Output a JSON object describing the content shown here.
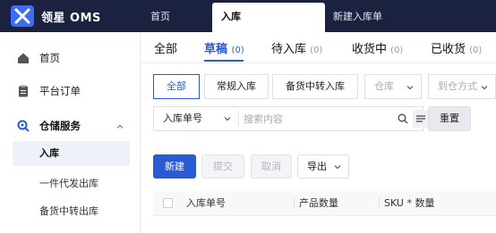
{
  "header": {
    "app_title": "领星 OMS",
    "tabs": [
      {
        "label": "首页"
      },
      {
        "label": "入库"
      },
      {
        "label": "新建入库单"
      }
    ]
  },
  "sidebar": {
    "items": [
      {
        "label": "首页",
        "icon": "home-icon"
      },
      {
        "label": "平台订单",
        "icon": "clipboard-icon"
      },
      {
        "label": "仓储服务",
        "icon": "warehouse-icon"
      }
    ],
    "sub_items": [
      {
        "label": "入库"
      },
      {
        "label": "一件代发出库"
      },
      {
        "label": "备货中转出库"
      }
    ]
  },
  "status_tabs": [
    {
      "label": "全部",
      "count": ""
    },
    {
      "label": "草稿",
      "count": "(0)"
    },
    {
      "label": "待入库",
      "count": "(0)"
    },
    {
      "label": "收货中",
      "count": "(0)"
    },
    {
      "label": "已收货",
      "count": "(0)"
    }
  ],
  "filters": {
    "type_buttons": [
      {
        "label": "全部"
      },
      {
        "label": "常规入库"
      },
      {
        "label": "备货中转入库"
      }
    ],
    "warehouse_placeholder": "仓库",
    "arrival_placeholder": "到仓方式",
    "search_field": "入库单号",
    "search_placeholder": "搜索内容",
    "reset_label": "重置"
  },
  "actions": {
    "new_label": "新建",
    "submit_label": "提交",
    "cancel_label": "取消",
    "export_label": "导出"
  },
  "table": {
    "columns": [
      "入库单号",
      "产品数量",
      "SKU * 数量"
    ]
  },
  "colors": {
    "topbar": "#1a2240",
    "accent": "#2a5bd7"
  }
}
